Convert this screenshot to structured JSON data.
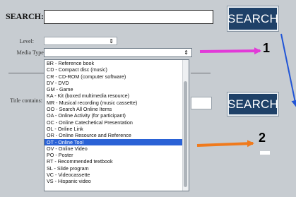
{
  "search": {
    "label": "SEARCH:",
    "value": "",
    "button1_label": "SEARCH",
    "button2_label": "SEARCH"
  },
  "filters": {
    "level_label": "Level:",
    "level_value": "",
    "media_type_label": "Media Type:",
    "media_type_value": "",
    "title_contains_label": "Title contains:"
  },
  "dropdown": {
    "options": [
      "BR - Reference book",
      "CD - Compact disc (music)",
      "CR - CD-ROM (computer software)",
      "DV - DVD",
      "GM - Game",
      "KA - Kit (boxed multimedia resource)",
      "MR - Musical recording (music cassette)",
      "OO - Search All Online Items",
      "OA - Online Activity (for participant)",
      "OC - Online Catechetical Presentation",
      "OL - Online Link",
      "OR - Online Resource and Reference",
      "OT - Online Tool",
      "OV - Online Video",
      "PO - Poster",
      "RT - Recommended textbook",
      "SL - Slide program",
      "VC - Videocassette",
      "VS - Hispanic video"
    ],
    "selected_index": 12
  },
  "annotations": {
    "callout1": "1",
    "callout2": "2",
    "arrow1_color": "#e23ad8",
    "arrow2_color": "#f07a1c",
    "arrow3_color": "#2155d6"
  },
  "colors": {
    "button_bg": "#1f4168",
    "selected_bg": "#2a62d6",
    "page_bg": "#c7ccd1"
  }
}
